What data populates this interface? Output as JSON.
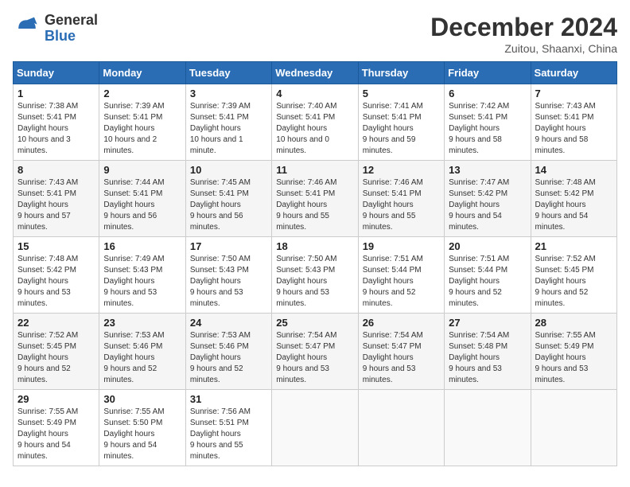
{
  "header": {
    "logo_line1": "General",
    "logo_line2": "Blue",
    "month": "December 2024",
    "location": "Zuitou, Shaanxi, China"
  },
  "weekdays": [
    "Sunday",
    "Monday",
    "Tuesday",
    "Wednesday",
    "Thursday",
    "Friday",
    "Saturday"
  ],
  "weeks": [
    [
      {
        "day": "1",
        "sunrise": "7:38 AM",
        "sunset": "5:41 PM",
        "daylight": "10 hours and 3 minutes."
      },
      {
        "day": "2",
        "sunrise": "7:39 AM",
        "sunset": "5:41 PM",
        "daylight": "10 hours and 2 minutes."
      },
      {
        "day": "3",
        "sunrise": "7:39 AM",
        "sunset": "5:41 PM",
        "daylight": "10 hours and 1 minute."
      },
      {
        "day": "4",
        "sunrise": "7:40 AM",
        "sunset": "5:41 PM",
        "daylight": "10 hours and 0 minutes."
      },
      {
        "day": "5",
        "sunrise": "7:41 AM",
        "sunset": "5:41 PM",
        "daylight": "9 hours and 59 minutes."
      },
      {
        "day": "6",
        "sunrise": "7:42 AM",
        "sunset": "5:41 PM",
        "daylight": "9 hours and 58 minutes."
      },
      {
        "day": "7",
        "sunrise": "7:43 AM",
        "sunset": "5:41 PM",
        "daylight": "9 hours and 58 minutes."
      }
    ],
    [
      {
        "day": "8",
        "sunrise": "7:43 AM",
        "sunset": "5:41 PM",
        "daylight": "9 hours and 57 minutes."
      },
      {
        "day": "9",
        "sunrise": "7:44 AM",
        "sunset": "5:41 PM",
        "daylight": "9 hours and 56 minutes."
      },
      {
        "day": "10",
        "sunrise": "7:45 AM",
        "sunset": "5:41 PM",
        "daylight": "9 hours and 56 minutes."
      },
      {
        "day": "11",
        "sunrise": "7:46 AM",
        "sunset": "5:41 PM",
        "daylight": "9 hours and 55 minutes."
      },
      {
        "day": "12",
        "sunrise": "7:46 AM",
        "sunset": "5:41 PM",
        "daylight": "9 hours and 55 minutes."
      },
      {
        "day": "13",
        "sunrise": "7:47 AM",
        "sunset": "5:42 PM",
        "daylight": "9 hours and 54 minutes."
      },
      {
        "day": "14",
        "sunrise": "7:48 AM",
        "sunset": "5:42 PM",
        "daylight": "9 hours and 54 minutes."
      }
    ],
    [
      {
        "day": "15",
        "sunrise": "7:48 AM",
        "sunset": "5:42 PM",
        "daylight": "9 hours and 53 minutes."
      },
      {
        "day": "16",
        "sunrise": "7:49 AM",
        "sunset": "5:43 PM",
        "daylight": "9 hours and 53 minutes."
      },
      {
        "day": "17",
        "sunrise": "7:50 AM",
        "sunset": "5:43 PM",
        "daylight": "9 hours and 53 minutes."
      },
      {
        "day": "18",
        "sunrise": "7:50 AM",
        "sunset": "5:43 PM",
        "daylight": "9 hours and 53 minutes."
      },
      {
        "day": "19",
        "sunrise": "7:51 AM",
        "sunset": "5:44 PM",
        "daylight": "9 hours and 52 minutes."
      },
      {
        "day": "20",
        "sunrise": "7:51 AM",
        "sunset": "5:44 PM",
        "daylight": "9 hours and 52 minutes."
      },
      {
        "day": "21",
        "sunrise": "7:52 AM",
        "sunset": "5:45 PM",
        "daylight": "9 hours and 52 minutes."
      }
    ],
    [
      {
        "day": "22",
        "sunrise": "7:52 AM",
        "sunset": "5:45 PM",
        "daylight": "9 hours and 52 minutes."
      },
      {
        "day": "23",
        "sunrise": "7:53 AM",
        "sunset": "5:46 PM",
        "daylight": "9 hours and 52 minutes."
      },
      {
        "day": "24",
        "sunrise": "7:53 AM",
        "sunset": "5:46 PM",
        "daylight": "9 hours and 52 minutes."
      },
      {
        "day": "25",
        "sunrise": "7:54 AM",
        "sunset": "5:47 PM",
        "daylight": "9 hours and 53 minutes."
      },
      {
        "day": "26",
        "sunrise": "7:54 AM",
        "sunset": "5:47 PM",
        "daylight": "9 hours and 53 minutes."
      },
      {
        "day": "27",
        "sunrise": "7:54 AM",
        "sunset": "5:48 PM",
        "daylight": "9 hours and 53 minutes."
      },
      {
        "day": "28",
        "sunrise": "7:55 AM",
        "sunset": "5:49 PM",
        "daylight": "9 hours and 53 minutes."
      }
    ],
    [
      {
        "day": "29",
        "sunrise": "7:55 AM",
        "sunset": "5:49 PM",
        "daylight": "9 hours and 54 minutes."
      },
      {
        "day": "30",
        "sunrise": "7:55 AM",
        "sunset": "5:50 PM",
        "daylight": "9 hours and 54 minutes."
      },
      {
        "day": "31",
        "sunrise": "7:56 AM",
        "sunset": "5:51 PM",
        "daylight": "9 hours and 55 minutes."
      },
      null,
      null,
      null,
      null
    ]
  ]
}
